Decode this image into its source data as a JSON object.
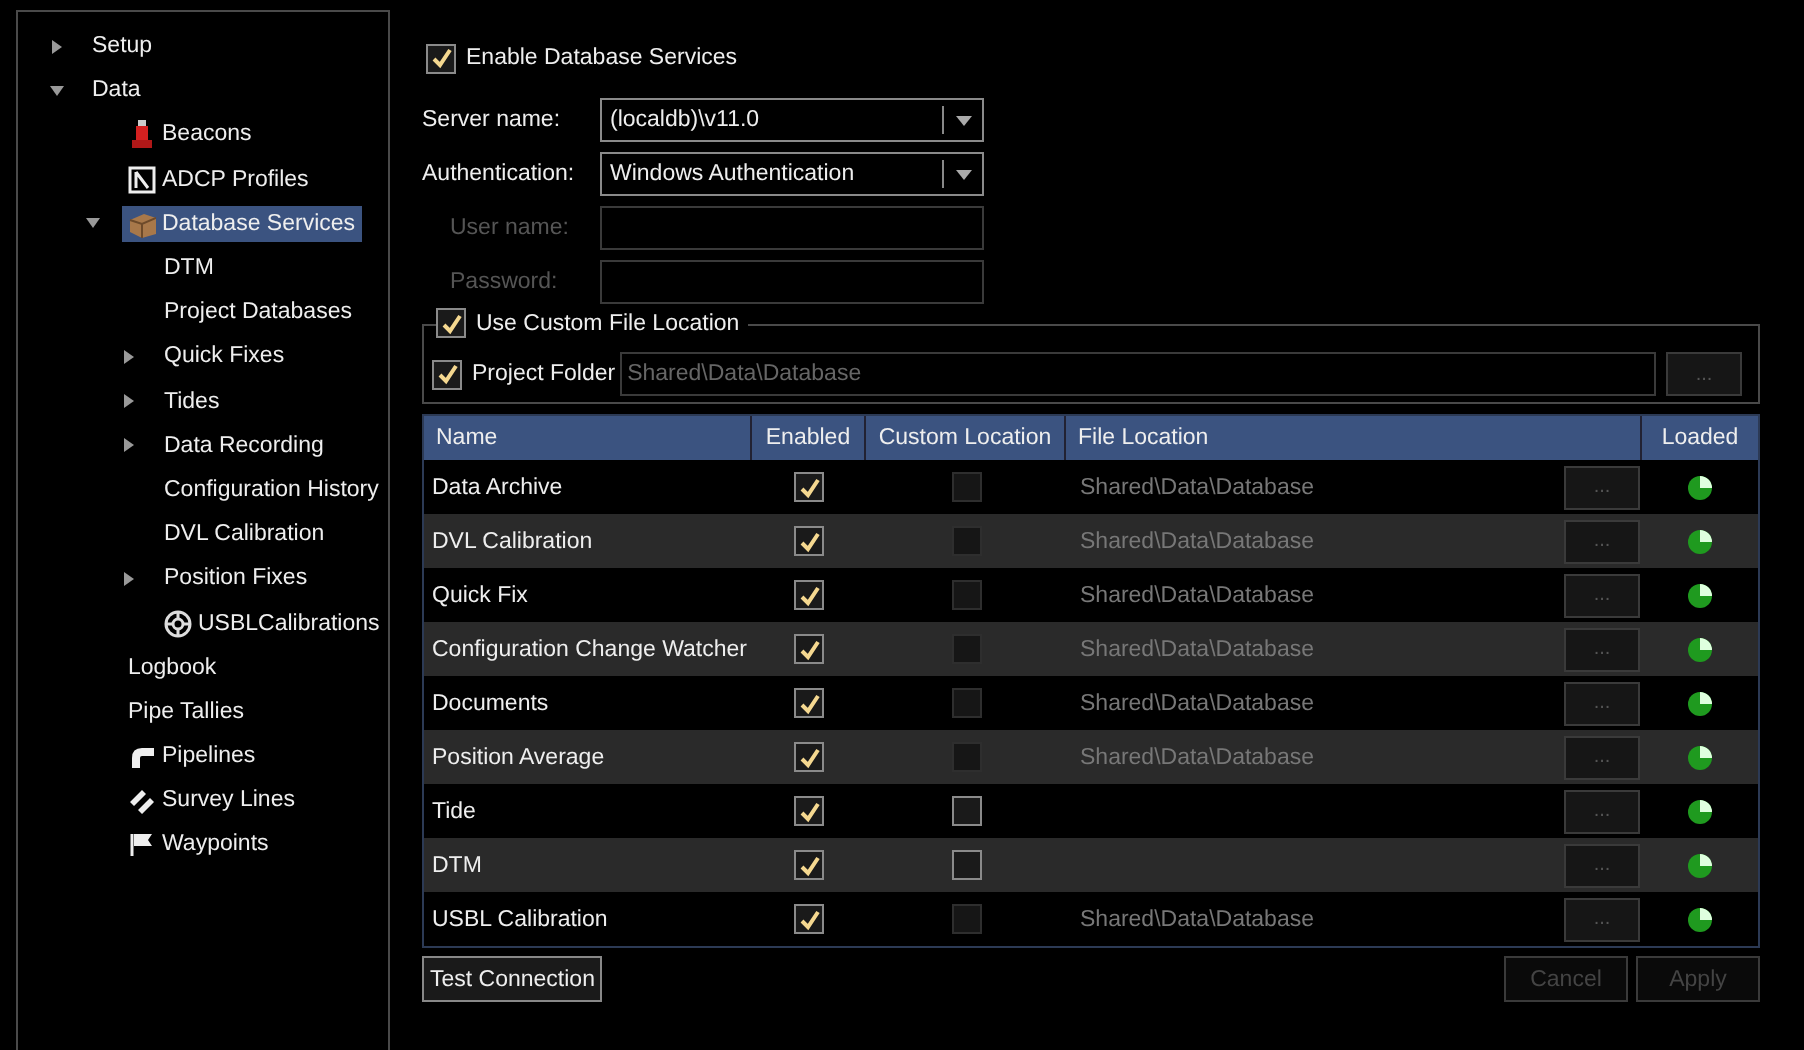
{
  "sidebar": {
    "items": [
      {
        "label": "Setup",
        "expanded": false,
        "selected": false
      },
      {
        "label": "Data",
        "expanded": true,
        "selected": false,
        "children": [
          {
            "label": "Beacons",
            "kind": "beacon",
            "selected": false
          },
          {
            "label": "ADCP Profiles",
            "kind": "adcp",
            "selected": false
          },
          {
            "label": "Database Services",
            "kind": "database",
            "expanded": true,
            "selected": true,
            "children": [
              {
                "label": "DTM",
                "selected": false
              },
              {
                "label": "Project Databases",
                "selected": false
              },
              {
                "label": "Quick Fixes",
                "expanded": false,
                "selected": false
              },
              {
                "label": "Tides",
                "expanded": false,
                "selected": false
              },
              {
                "label": "Data Recording",
                "expanded": false,
                "selected": false
              },
              {
                "label": "Configuration History",
                "selected": false
              },
              {
                "label": "DVL Calibration",
                "selected": false
              },
              {
                "label": "Position Fixes",
                "expanded": false,
                "selected": false
              },
              {
                "label": "USBLCalibrations",
                "kind": "usbl",
                "selected": false
              }
            ]
          },
          {
            "label": "Logbook",
            "selected": false
          },
          {
            "label": "Pipe Tallies",
            "selected": false
          },
          {
            "label": "Pipelines",
            "kind": "pipeline",
            "selected": false
          },
          {
            "label": "Survey Lines",
            "kind": "survey",
            "selected": false
          },
          {
            "label": "Waypoints",
            "kind": "flag",
            "selected": false
          }
        ]
      }
    ]
  },
  "enable_services": {
    "label": "Enable Database Services",
    "checked": true
  },
  "form": [
    {
      "label": "Server name:",
      "kind": "combo",
      "value": "(localdb)\\v11.0"
    },
    {
      "label": "Authentication:",
      "kind": "combo",
      "value": "Windows Authentication"
    },
    {
      "label": "User name:",
      "kind": "text",
      "disabled": true
    },
    {
      "label": "Password:",
      "kind": "text",
      "disabled": true
    }
  ],
  "custom_location": {
    "label": "Use Custom File Location",
    "checked": true,
    "project_folder": {
      "label": "Project Folder",
      "checked": true,
      "value": "Shared\\Data\\Database",
      "browse": "...",
      "browse_disabled": true
    }
  },
  "table": {
    "columns": [
      "Name",
      "Enabled",
      "Custom Location",
      "File Location",
      "Loaded"
    ],
    "rows": [
      {
        "name": "Data Archive",
        "enabled": true,
        "custom": false,
        "custom_disabled": true,
        "file_location": "Shared\\Data\\Database",
        "browse": "...",
        "loaded": true
      },
      {
        "name": "DVL Calibration",
        "enabled": true,
        "custom": false,
        "custom_disabled": true,
        "file_location": "Shared\\Data\\Database",
        "browse": "...",
        "loaded": true
      },
      {
        "name": "Quick Fix",
        "enabled": true,
        "custom": false,
        "custom_disabled": true,
        "file_location": "Shared\\Data\\Database",
        "browse": "...",
        "loaded": true
      },
      {
        "name": "Configuration Change Watcher",
        "enabled": true,
        "custom": false,
        "custom_disabled": true,
        "file_location": "Shared\\Data\\Database",
        "browse": "...",
        "loaded": true
      },
      {
        "name": "Documents",
        "enabled": true,
        "custom": false,
        "custom_disabled": true,
        "file_location": "Shared\\Data\\Database",
        "browse": "...",
        "loaded": true
      },
      {
        "name": "Position Average",
        "enabled": true,
        "custom": false,
        "custom_disabled": true,
        "file_location": "Shared\\Data\\Database",
        "browse": "...",
        "loaded": true
      },
      {
        "name": "Tide",
        "enabled": true,
        "custom": false,
        "custom_disabled": false,
        "browse": "...",
        "loaded": true
      },
      {
        "name": "DTM",
        "enabled": true,
        "custom": false,
        "custom_disabled": false,
        "browse": "...",
        "loaded": true
      },
      {
        "name": "USBL Calibration",
        "enabled": true,
        "custom": false,
        "custom_disabled": true,
        "file_location": "Shared\\Data\\Database",
        "browse": "...",
        "loaded": true
      }
    ]
  },
  "buttons": [
    {
      "label": "Test Connection",
      "disabled": false,
      "kind": "left"
    },
    {
      "label": "Cancel",
      "disabled": true,
      "kind": "right"
    },
    {
      "label": "Apply",
      "disabled": true,
      "kind": "right"
    }
  ]
}
